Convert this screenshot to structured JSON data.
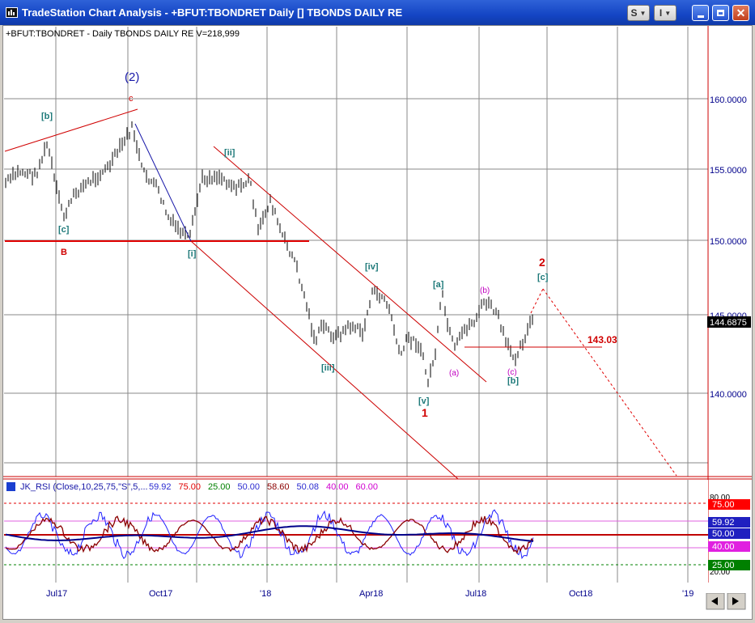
{
  "window": {
    "title": "TradeStation Chart Analysis - +BFUT:TBONDRET Daily [] TBONDS DAILY RE",
    "buttons": {
      "s_label": "S",
      "i_label": "I"
    }
  },
  "chart_header": {
    "text": "+BFUT:TBONDRET - Daily  TBONDS DAILY RE  V=218,999"
  },
  "price_panel": {
    "axis_labels": [
      "160.0000",
      "155.0000",
      "150.0000",
      "145.0000",
      "140.0000"
    ],
    "last_price": "144.6875",
    "target_label": "143.03"
  },
  "wave_labels": {
    "w2_paren": "(2)",
    "c_top": "c",
    "b_left": "[b]",
    "c_left": "[c]",
    "B": "B",
    "i": "[i]",
    "ii": "[ii]",
    "iii": "[iii]",
    "iv": "[iv]",
    "v": "[v]",
    "one": "1",
    "a_br": "[a]",
    "a_paren": "(a)",
    "b_paren": "(b)",
    "c_paren": "(c)",
    "b_br": "[b]",
    "two": "2",
    "c_br": "[c]"
  },
  "rsi_panel": {
    "legend_name": "JK_RSI (Close,10,25,75,\"S\",5,...",
    "legend_values": [
      {
        "text": "59.92",
        "color": "#2b2bd0"
      },
      {
        "text": "75.00",
        "color": "#e00000"
      },
      {
        "text": "25.00",
        "color": "#008000"
      },
      {
        "text": "50.00",
        "color": "#2b2bd0"
      },
      {
        "text": "58.60",
        "color": "#8b0000"
      },
      {
        "text": "50.08",
        "color": "#2b2bd0"
      },
      {
        "text": "40.00",
        "color": "#d000d0"
      },
      {
        "text": "60.00",
        "color": "#d000d0"
      }
    ],
    "axis_top": "80.00",
    "badges": [
      {
        "text": "75.00",
        "bg": "#ff0000",
        "fg": "#ffffff"
      },
      {
        "text": "59.92",
        "bg": "#2020c0",
        "fg": "#ffffff"
      },
      {
        "text": "50.00",
        "bg": "#2020c0",
        "fg": "#ffffff"
      },
      {
        "text": "40.00",
        "bg": "#e020e0",
        "fg": "#ffffff"
      },
      {
        "text": "25.00",
        "bg": "#008000",
        "fg": "#ffffff"
      }
    ],
    "axis_bottom": "20.00"
  },
  "x_axis": {
    "labels": [
      "Jul17",
      "Oct17",
      "'18",
      "Apr18",
      "Jul18",
      "Oct18",
      "'19"
    ]
  },
  "colors": {
    "titlebar": "#1445c4",
    "price_bars": "#000000",
    "support_line": "#e00000",
    "channel": "#cc0000",
    "wave_blue": "#1818a8",
    "wave_teal": "#1f7a7a",
    "wave_red": "#d00000",
    "wave_magenta": "#c000c0",
    "rsi_fast": "#2020ff",
    "rsi_slow": "#8b0000",
    "rsi_avg": "#00008b"
  }
}
